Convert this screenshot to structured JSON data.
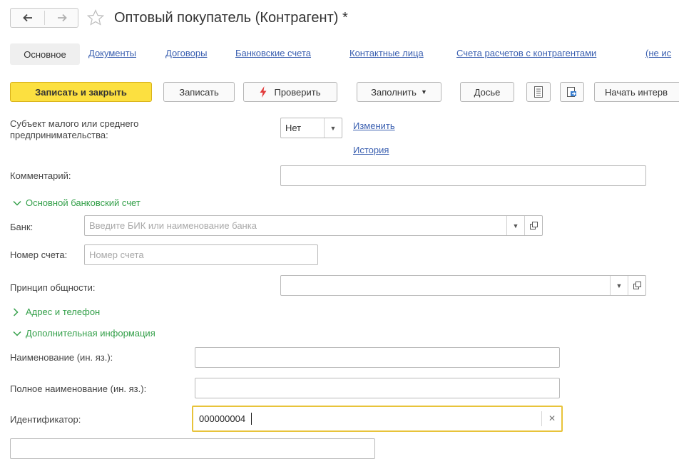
{
  "window": {
    "title": "Оптовый покупатель (Контрагент) *"
  },
  "tabs": {
    "active": "Основное",
    "links": [
      "Документы",
      "Договоры",
      "Банковские счета",
      "Контактные лица",
      "Счета расчетов с контрагентами",
      "(не ис"
    ]
  },
  "toolbar": {
    "save_close": "Записать и закрыть",
    "save": "Записать",
    "check": "Проверить",
    "fill": "Заполнить",
    "dossier": "Досье",
    "start": "Начать интерв"
  },
  "form": {
    "sme_label": "Субъект малого или среднего\nпредпринимательства:",
    "sme_value": "Нет",
    "change_link": "Изменить",
    "history_link": "История",
    "comment_label": "Комментарий:",
    "bank_section": "Основной банковский счет",
    "bank_label": "Банк:",
    "bank_placeholder": "Введите БИК или наименование банка",
    "account_label": "Номер счета:",
    "account_placeholder": "Номер счета",
    "principle_label": "Принцип общности:",
    "address_section": "Адрес и телефон",
    "extra_section": "Дополнительная информация",
    "name_foreign_label": "Наименование (ин. яз.):",
    "full_name_foreign_label": "Полное наименование (ин. яз.):",
    "identifier_label": "Идентификатор:",
    "identifier_value": "000000004"
  },
  "colors": {
    "accent_yellow": "#fce040",
    "link_blue": "#3a5fb0",
    "section_green": "#34a04a",
    "focus_border": "#e8c33a"
  }
}
